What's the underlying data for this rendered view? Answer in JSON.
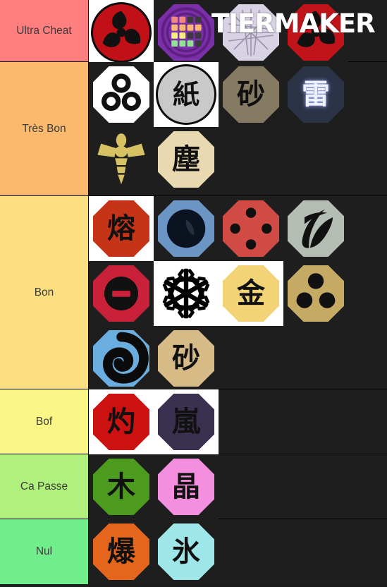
{
  "app": {
    "watermark": "TIERMAKER"
  },
  "tiers": [
    {
      "label": "Ultra Cheat",
      "color": "#FF7F7F",
      "items": [
        {
          "name": "mangekyo-sharingan-icon",
          "glyph": "",
          "shape": "circle",
          "bg": "#C11017",
          "cell_bg": "white",
          "kind": "sharingan"
        },
        {
          "name": "tiermaker-logo-icon",
          "glyph": "",
          "shape": "octagon",
          "bg": "#7B2FA8",
          "cell_bg": "dark",
          "kind": "logo"
        },
        {
          "name": "shatter-release-icon",
          "glyph": "",
          "shape": "octagon",
          "bg": "#D8D2E4",
          "cell_bg": "dark",
          "kind": "shatter"
        },
        {
          "name": "red-sharingan-icon",
          "glyph": "",
          "shape": "octagon",
          "bg": "#C0141A",
          "cell_bg": "dark",
          "kind": "sharingan"
        }
      ]
    },
    {
      "label": "Très Bon",
      "color": "#FBB96E",
      "items": [
        {
          "name": "swirl-trio-release-icon",
          "glyph": "",
          "shape": "octagon",
          "bg": "#FFFFFF",
          "cell_bg": "dark",
          "kind": "trefoil"
        },
        {
          "name": "paper-release-icon",
          "glyph": "紙",
          "shape": "circle",
          "bg": "#C9C9C9",
          "cell_bg": "white",
          "kind": "kanji"
        },
        {
          "name": "sand-release-dark-icon",
          "glyph": "砂",
          "shape": "octagon",
          "bg": "#857B63",
          "cell_bg": "dark",
          "kind": "kanji"
        },
        {
          "name": "lightning-release-icon",
          "glyph": "雷",
          "shape": "octagon",
          "bg": "#2B3347",
          "cell_bg": "dark",
          "kind": "kanji-light"
        },
        {
          "name": "insect-release-icon",
          "glyph": "",
          "shape": "none",
          "bg": "#D6C263",
          "cell_bg": "dark",
          "kind": "bee"
        },
        {
          "name": "dust-release-icon",
          "glyph": "塵",
          "shape": "octagon",
          "bg": "#E8D9B0",
          "cell_bg": "dark",
          "kind": "kanji"
        }
      ]
    },
    {
      "label": "Bon",
      "color": "#FADE7F",
      "items": [
        {
          "name": "lava-release-icon",
          "glyph": "熔",
          "shape": "octagon",
          "bg": "#C63418",
          "cell_bg": "white",
          "kind": "kanji"
        },
        {
          "name": "dark-sphere-release-icon",
          "glyph": "",
          "shape": "octagon",
          "bg": "#6B95C4",
          "cell_bg": "dark",
          "kind": "sphere"
        },
        {
          "name": "rinnegan-four-dot-icon",
          "glyph": "",
          "shape": "octagon",
          "bg": "#CF4B44",
          "cell_bg": "dark",
          "kind": "fourdot"
        },
        {
          "name": "storm-swirl-release-icon",
          "glyph": "",
          "shape": "octagon",
          "bg": "#B3BDB3",
          "cell_bg": "dark",
          "kind": "swirlstripe"
        },
        {
          "name": "blocked-release-icon",
          "glyph": "",
          "shape": "octagon",
          "bg": "#C9213A",
          "cell_bg": "dark",
          "kind": "nosign"
        },
        {
          "name": "ice-snowflake-icon",
          "glyph": "",
          "shape": "none",
          "bg": "#000000",
          "cell_bg": "white",
          "kind": "snowflake"
        },
        {
          "name": "gold-release-icon",
          "glyph": "金",
          "shape": "octagon",
          "bg": "#F2D477",
          "cell_bg": "white",
          "kind": "kanji"
        },
        {
          "name": "magnet-release-icon",
          "glyph": "",
          "shape": "octagon",
          "bg": "#C5AA63",
          "cell_bg": "dark",
          "kind": "tomoe3"
        },
        {
          "name": "blue-spiral-release-icon",
          "glyph": "",
          "shape": "octagon",
          "bg": "#6AAEE0",
          "cell_bg": "dark",
          "kind": "spiral"
        },
        {
          "name": "sand-release-icon",
          "glyph": "砂",
          "shape": "octagon",
          "bg": "#D6BB86",
          "cell_bg": "dark",
          "kind": "kanji"
        }
      ]
    },
    {
      "label": "Bof",
      "color": "#FBF787",
      "items": [
        {
          "name": "scorch-release-icon",
          "glyph": "灼",
          "shape": "octagon",
          "bg": "#CC1111",
          "cell_bg": "white",
          "kind": "kanji"
        },
        {
          "name": "storm-release-icon",
          "glyph": "嵐",
          "shape": "octagon",
          "bg": "#3A3050",
          "cell_bg": "white",
          "kind": "kanji"
        }
      ]
    },
    {
      "label": "Ca Passe",
      "color": "#B0F07C",
      "items": [
        {
          "name": "wood-release-icon",
          "glyph": "木",
          "shape": "octagon",
          "bg": "#4C9A1E",
          "cell_bg": "dark",
          "kind": "kanji"
        },
        {
          "name": "crystal-release-icon",
          "glyph": "晶",
          "shape": "octagon",
          "bg": "#F48FE0",
          "cell_bg": "dark",
          "kind": "kanji"
        }
      ]
    },
    {
      "label": "Nul",
      "color": "#71EE8C",
      "items": [
        {
          "name": "explosion-release-icon",
          "glyph": "爆",
          "shape": "octagon",
          "bg": "#E4651C",
          "cell_bg": "dark",
          "kind": "kanji"
        },
        {
          "name": "ice-release-icon",
          "glyph": "氷",
          "shape": "octagon",
          "bg": "#9FE6E8",
          "cell_bg": "dark",
          "kind": "kanji"
        }
      ]
    }
  ]
}
